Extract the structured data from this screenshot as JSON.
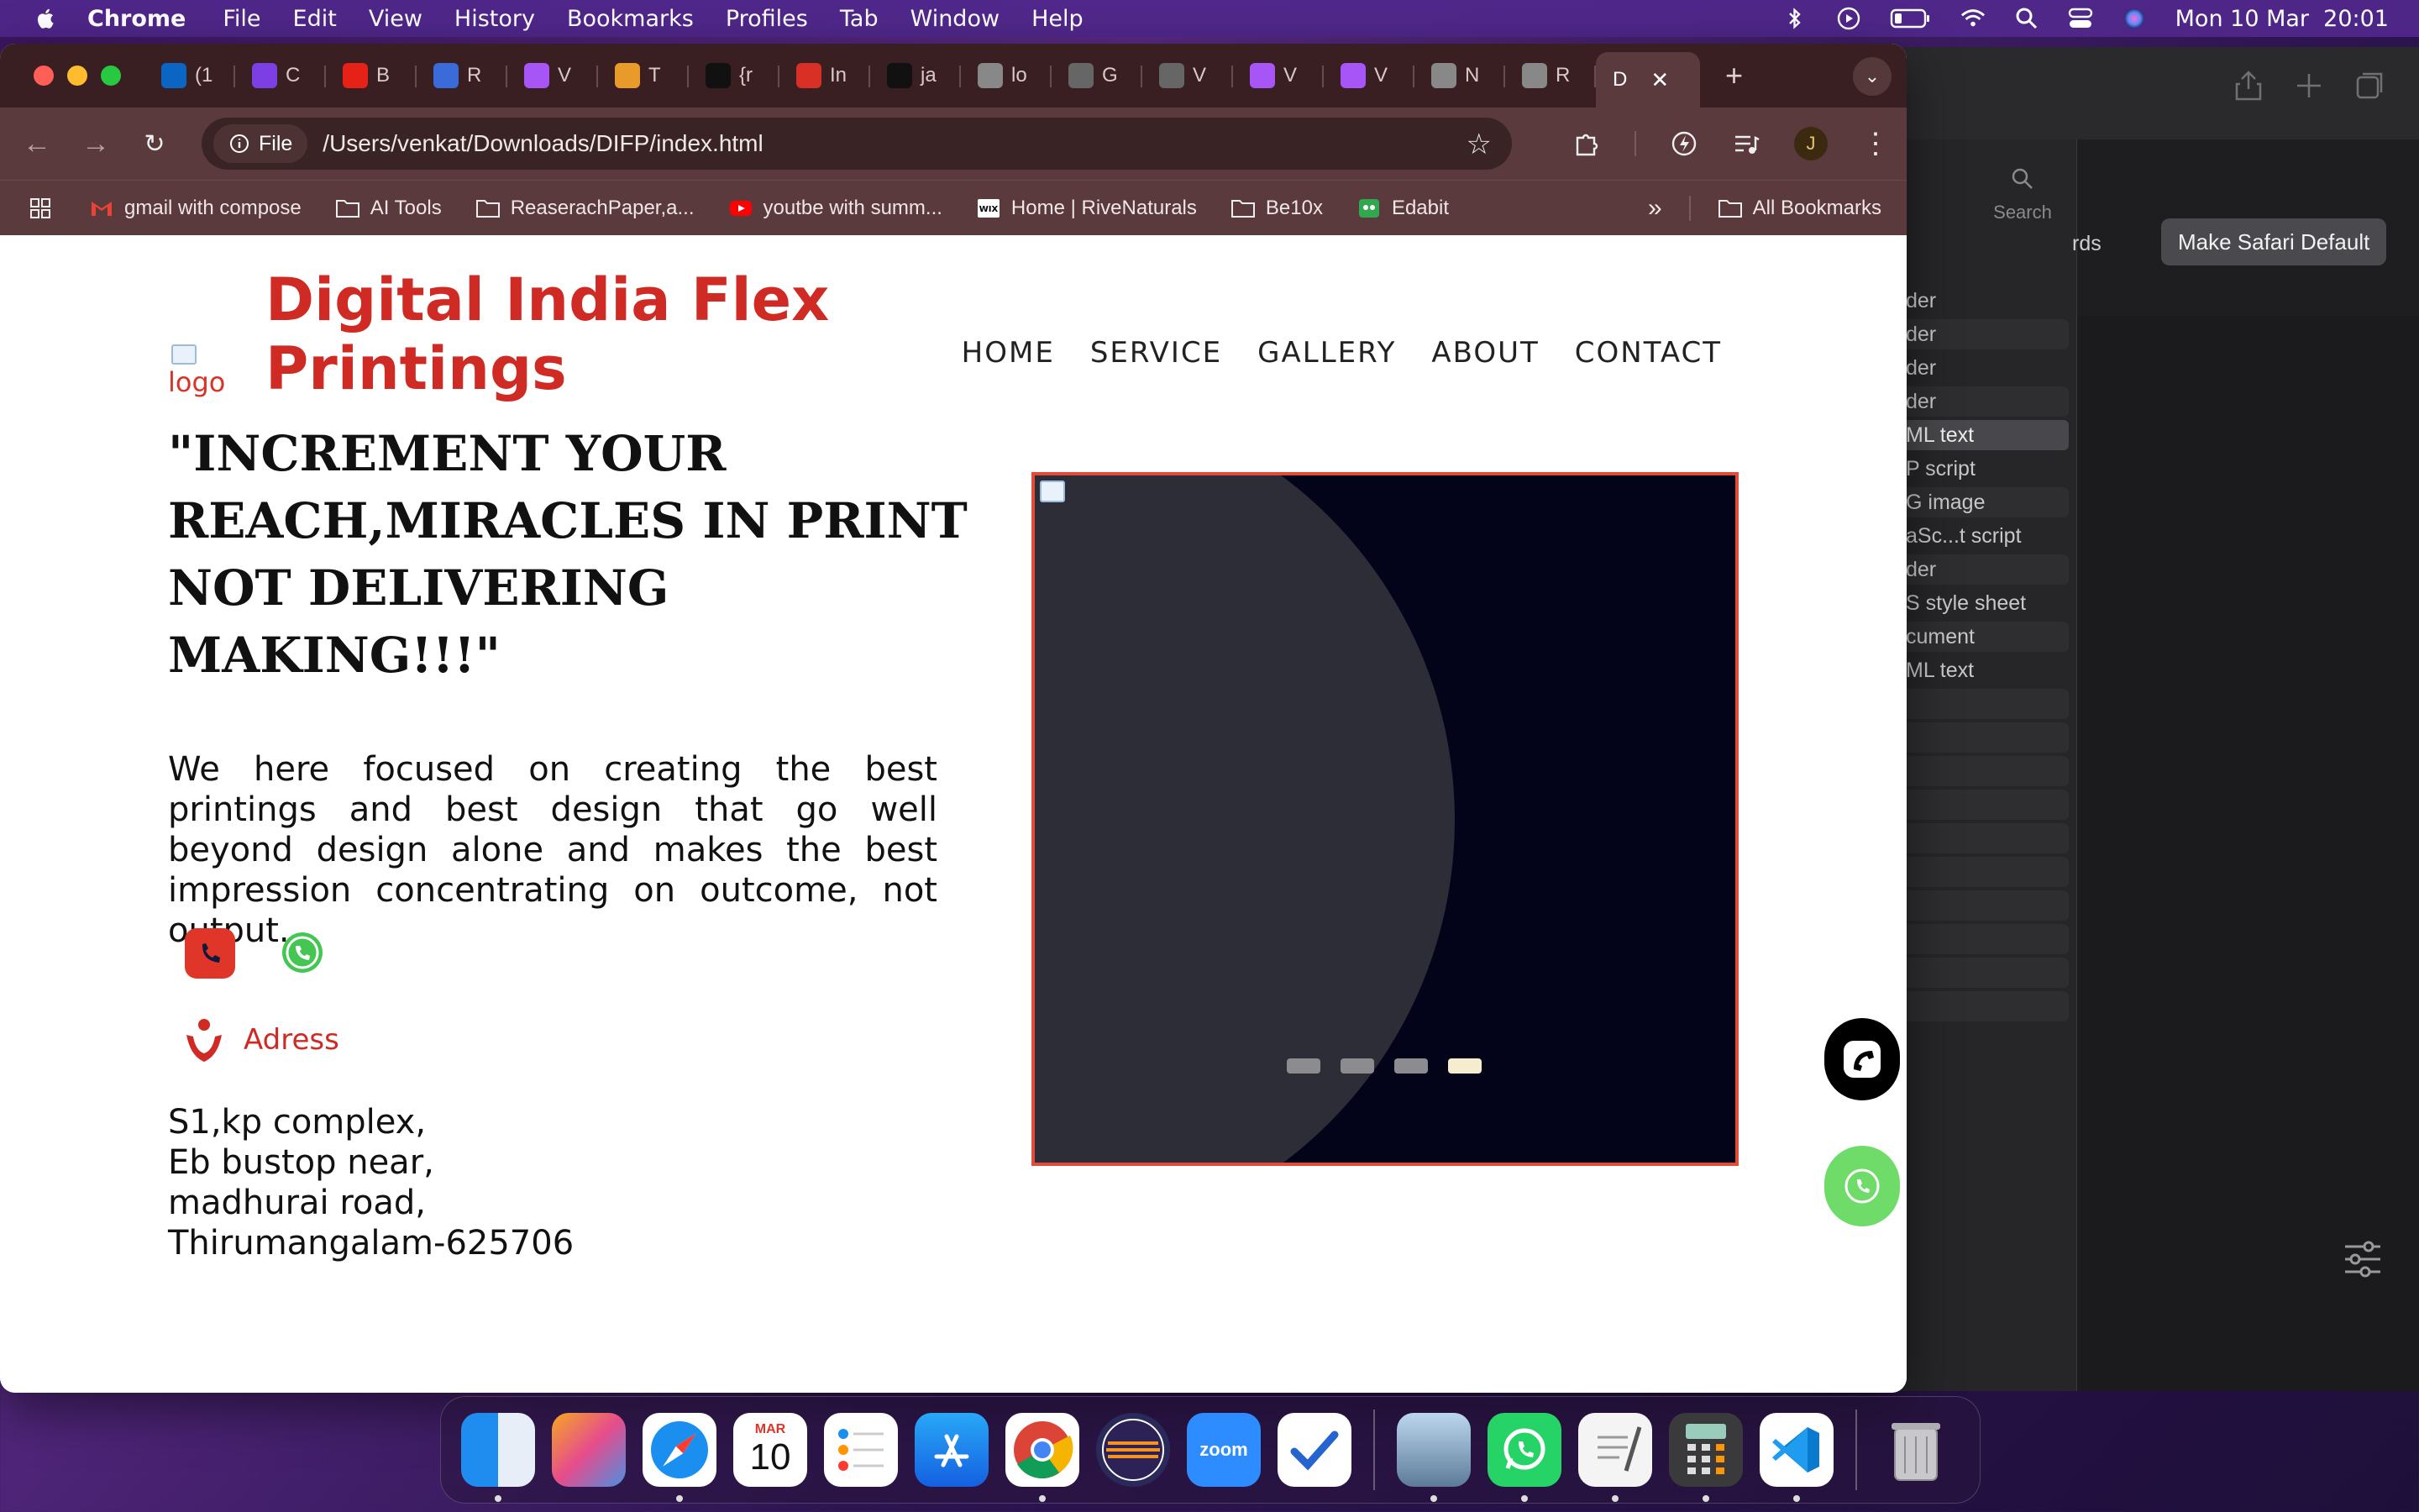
{
  "menubar": {
    "app": "Chrome",
    "items": [
      "File",
      "Edit",
      "View",
      "History",
      "Bookmarks",
      "Profiles",
      "Tab",
      "Window",
      "Help"
    ],
    "datetime": "Mon 10 Mar  20:01"
  },
  "chrome": {
    "tabs": [
      {
        "label": "(1",
        "icon": "linkedin-icon",
        "color": "#0a66c2"
      },
      {
        "label": "C",
        "icon": "u-icon",
        "color": "#7b3fe4"
      },
      {
        "label": "B",
        "icon": "youtube-icon",
        "color": "#e62117"
      },
      {
        "label": "R",
        "icon": "message-icon",
        "color": "#3b6bd8"
      },
      {
        "label": "V",
        "icon": "vite-icon",
        "color": "#a855f7"
      },
      {
        "label": "T",
        "icon": "translate-icon",
        "color": "#e89a2a"
      },
      {
        "label": "{r",
        "icon": "openai-icon",
        "color": "#111111"
      },
      {
        "label": "In",
        "icon": "gmail-icon",
        "color": "#d93025"
      },
      {
        "label": "ja",
        "icon": "github-icon",
        "color": "#111111"
      },
      {
        "label": "lo",
        "icon": "globe-icon",
        "color": "#888888"
      },
      {
        "label": "G",
        "icon": "ring-icon",
        "color": "#666666"
      },
      {
        "label": "V",
        "icon": "ring-icon",
        "color": "#666666"
      },
      {
        "label": "V",
        "icon": "vite-icon",
        "color": "#a855f7"
      },
      {
        "label": "V",
        "icon": "vite-icon",
        "color": "#a855f7"
      },
      {
        "label": "N",
        "icon": "chrome-icon",
        "color": "#888888"
      },
      {
        "label": "R",
        "icon": "grid-icon",
        "color": "#888888"
      }
    ],
    "active_tab": {
      "label": "D"
    },
    "chip_label": "File",
    "url": "/Users/venkat/Downloads/DIFP/index.html",
    "avatar_letter": "J",
    "bookmarks": [
      {
        "label": "gmail with compose",
        "icon": "gmail-icon"
      },
      {
        "label": "AI Tools",
        "icon": "folder-icon"
      },
      {
        "label": "ReaserachPaper,a...",
        "icon": "folder-icon"
      },
      {
        "label": "youtbe with summ...",
        "icon": "youtube-icon"
      },
      {
        "label": "Home | RiveNaturals",
        "icon": "wix-icon"
      },
      {
        "label": "Be10x",
        "icon": "folder-icon"
      },
      {
        "label": "Edabit",
        "icon": "edabit-icon"
      }
    ],
    "all_bookmarks": "All Bookmarks"
  },
  "page": {
    "logo_alt": "logo",
    "brand": "Digital India Flex Printings",
    "nav": [
      "HOME",
      "SERVICE",
      "GALLERY",
      "ABOUT",
      "CONTACT"
    ],
    "headline": "\"INCREMENT YOUR REACH,MIRACLES IN PRINT NOT DELIVERING MAKING!!!\"",
    "description": "We here focused on creating the best printings and best design that go well beyond design alone and makes the best impression concentrating on outcome, not output.",
    "address_label": "Adress",
    "address_lines": [
      "S1,kp complex,",
      "Eb bustop near,",
      "madhurai road,",
      "Thirumangalam-625706"
    ],
    "slider": {
      "slide_count": 4,
      "active_index": 3
    }
  },
  "safari": {
    "make_default": "Make Safari Default",
    "search_label": "Search",
    "partial_label": "rds",
    "sidebar_rows": [
      "der",
      "der",
      "der",
      "der",
      "ML text",
      "P script",
      "G image",
      "aSc...t script",
      "der",
      "S style sheet",
      "cument",
      "ML text"
    ]
  },
  "dock": {
    "calendar_month": "MAR",
    "calendar_day": "10",
    "zoom_label": "zoom"
  },
  "colors": {
    "brand_red": "#d02a25",
    "slider_border": "#e24a3a",
    "whatsapp_green": "#6fdc6a"
  }
}
